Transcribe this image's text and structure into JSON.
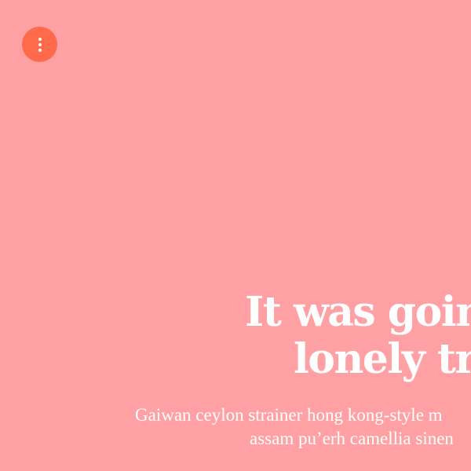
{
  "menu": {
    "icon": "more-vertical-icon",
    "color": "#ff6b4a"
  },
  "background_color": "#ffa1a4",
  "hero": {
    "title_line1": "It was going",
    "title_line2": "lonely trip",
    "subtitle_line1": "Gaiwan ceylon strainer hong kong-style m",
    "subtitle_line2": "assam pu’erh camellia sinen"
  }
}
